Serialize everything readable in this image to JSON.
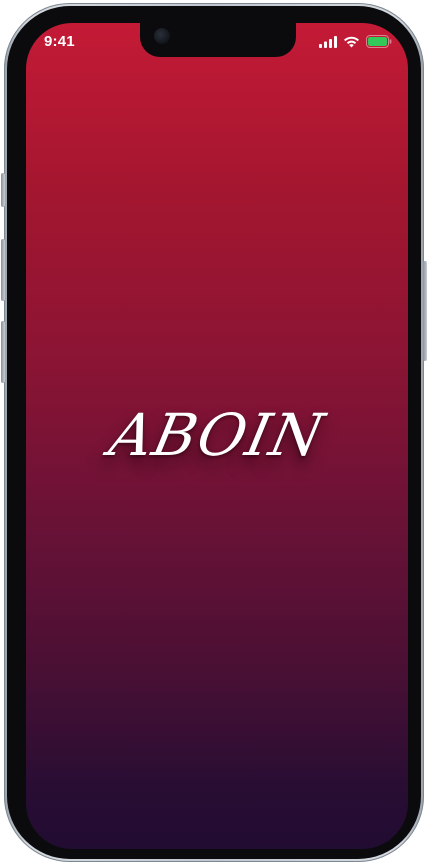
{
  "status_bar": {
    "time": "9:41",
    "signal_icon": "cellular-signal-icon",
    "wifi_icon": "wifi-icon",
    "battery_icon": "battery-icon",
    "battery_color": "#34c759"
  },
  "splash": {
    "logo_text": "ABOIN",
    "gradient_top": "#c41a36",
    "gradient_bottom": "#210c32"
  }
}
